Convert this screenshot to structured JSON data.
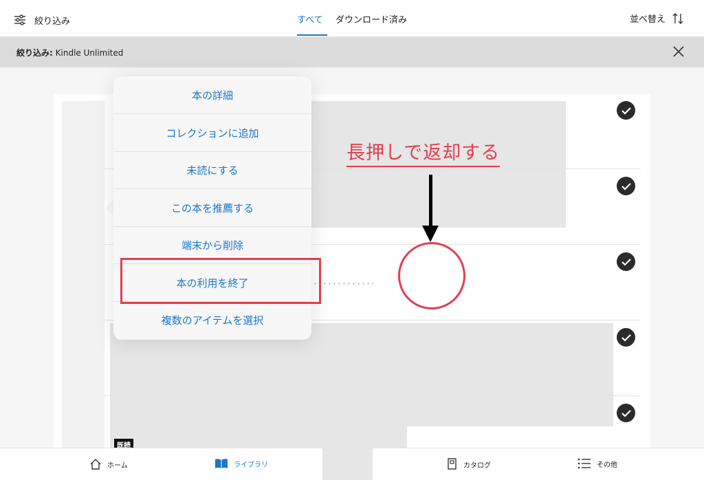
{
  "topbar": {
    "filter_label": "絞り込み",
    "tabs": [
      {
        "label": "すべて",
        "active": true
      },
      {
        "label": "ダウンロード済み",
        "active": false
      }
    ],
    "sort_label": "並べ替え"
  },
  "filterbar": {
    "prefix": "絞り込み:",
    "value": "Kindle Unlimited"
  },
  "menu": {
    "items": [
      "本の詳細",
      "コレクションに追加",
      "未読にする",
      "この本を推薦する",
      "端末から削除",
      "本の利用を終了",
      "複数のアイテムを選択"
    ]
  },
  "annotation": {
    "text": "長押しで返却する"
  },
  "badge": "既読",
  "bottomnav": {
    "items": [
      {
        "label": "ホーム",
        "icon": "home-icon",
        "active": false
      },
      {
        "label": "ライブラリ",
        "icon": "book-icon",
        "active": true
      },
      {
        "label": "カタログ",
        "icon": "catalog-icon",
        "active": false
      },
      {
        "label": "その他",
        "icon": "more-icon",
        "active": false
      }
    ]
  },
  "colors": {
    "accent": "#1a77c7",
    "annotation": "#e43d50",
    "filterbar_bg": "#dcdcdc"
  }
}
